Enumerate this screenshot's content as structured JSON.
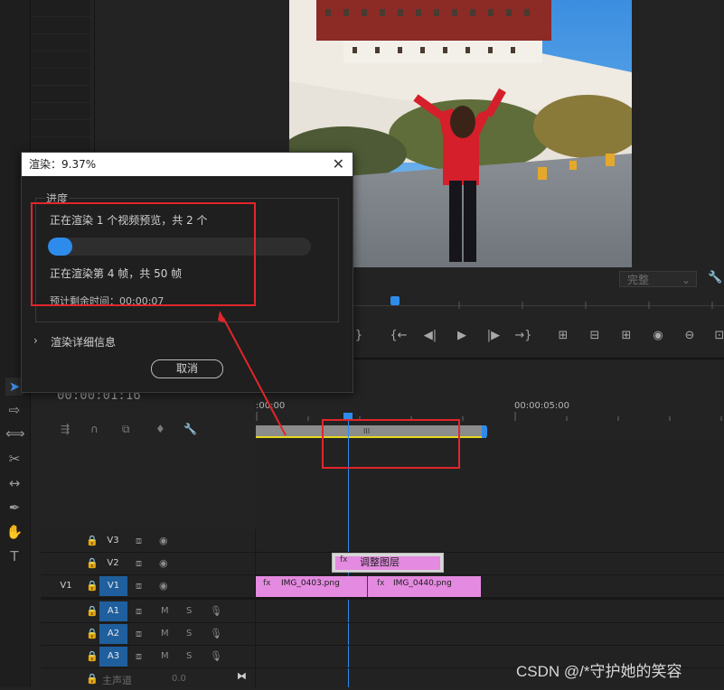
{
  "dialog": {
    "title": "渲染：9.37%",
    "group_label": "进度",
    "rendering_previews": "正在渲染 1 个视频预览，共 2 个",
    "progress_fraction": 0.0937,
    "rendering_frames": "正在渲染第 4 帧，共 50 帧",
    "eta_label": "预计剩余时间：",
    "eta_value": "00:00:07",
    "details_label": "渲染详细信息",
    "cancel_label": "取消"
  },
  "monitor": {
    "quality": "完整"
  },
  "timeline": {
    "timecode": "00:00:01:16",
    "ruler_start": ":00:00",
    "ruler_mark": "00:00:05:00",
    "tracks": [
      {
        "id": "V3",
        "label": "V3"
      },
      {
        "id": "V2",
        "label": "V2"
      },
      {
        "id": "V1",
        "label": "V1",
        "source": "V1"
      },
      {
        "id": "A1",
        "label": "A1"
      },
      {
        "id": "A2",
        "label": "A2"
      },
      {
        "id": "A3",
        "label": "A3"
      }
    ],
    "master_label": "主声道",
    "master_value": "0.0",
    "adjustment_clip": "调整图层",
    "clips": [
      {
        "name": "IMG_0403.png"
      },
      {
        "name": "IMG_0440.png"
      }
    ],
    "work_area_marker": "III",
    "mute": "M",
    "solo": "S"
  },
  "watermark": "CSDN @/*守护她的笑容"
}
